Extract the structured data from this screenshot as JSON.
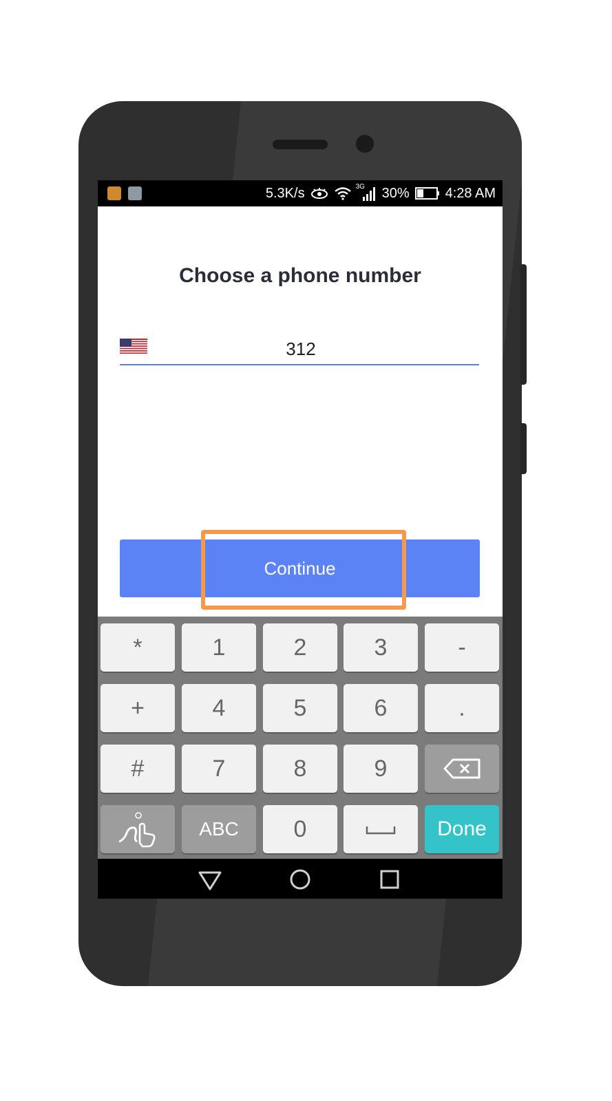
{
  "status_bar": {
    "net_speed": "5.3K/s",
    "network_type": "3G",
    "battery": "30%",
    "time": "4:28 AM",
    "icons": [
      "app-notification-icon",
      "image-notification-icon",
      "eye-icon",
      "wifi-icon",
      "signal-icon",
      "battery-icon"
    ]
  },
  "screen": {
    "title": "Choose a phone number",
    "phone_input": {
      "value": "312",
      "country_flag": "us-flag-icon"
    },
    "continue_label": "Continue"
  },
  "keyboard": {
    "rows": [
      [
        "*",
        "1",
        "2",
        "3",
        "-"
      ],
      [
        "+",
        "4",
        "5",
        "6",
        "."
      ],
      [
        "#",
        "7",
        "8",
        "9",
        "backspace-icon"
      ],
      [
        "gesture-icon",
        "ABC",
        "0",
        "space-icon",
        "Done"
      ]
    ]
  },
  "nav_bar": {
    "buttons": [
      "back-icon",
      "home-icon",
      "recents-icon"
    ]
  },
  "colors": {
    "accent": "#5b83f5",
    "highlight": "#f59a4d",
    "done_key": "#33c3c8"
  }
}
